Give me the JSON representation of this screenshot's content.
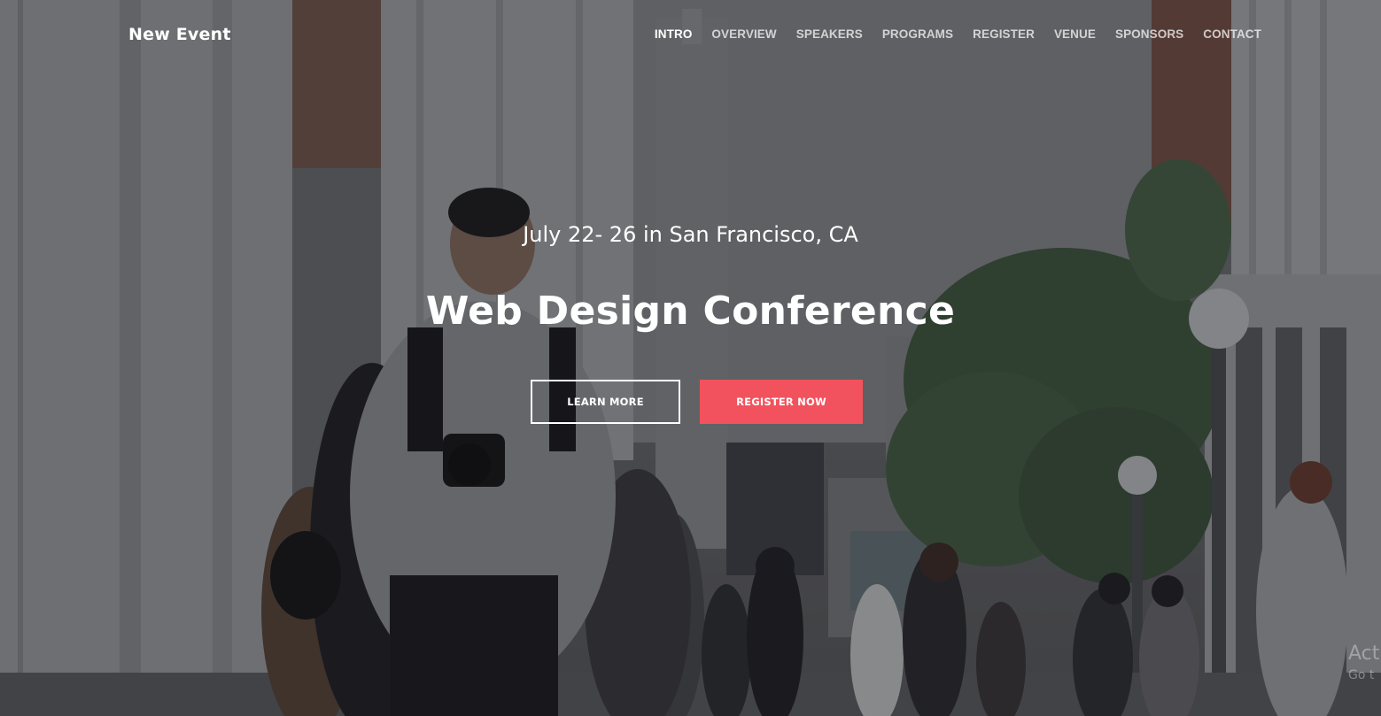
{
  "header": {
    "brand": "New Event",
    "nav": [
      {
        "label": "INTRO",
        "active": true
      },
      {
        "label": "OVERVIEW",
        "active": false
      },
      {
        "label": "SPEAKERS",
        "active": false
      },
      {
        "label": "PROGRAMS",
        "active": false
      },
      {
        "label": "REGISTER",
        "active": false
      },
      {
        "label": "VENUE",
        "active": false
      },
      {
        "label": "SPONSORS",
        "active": false
      },
      {
        "label": "CONTACT",
        "active": false
      }
    ]
  },
  "hero": {
    "subtitle": "July 22- 26 in San Francisco, CA",
    "title": "Web Design Conference",
    "learn_more_label": "LEARN MORE",
    "register_label": "REGISTER NOW",
    "background_image": "photographer-and-crowd-walking-city-alley-photo"
  },
  "watermark": {
    "line1": "Act",
    "line2": "Go t"
  },
  "colors": {
    "accent": "#f2525d",
    "text": "#ffffff"
  }
}
